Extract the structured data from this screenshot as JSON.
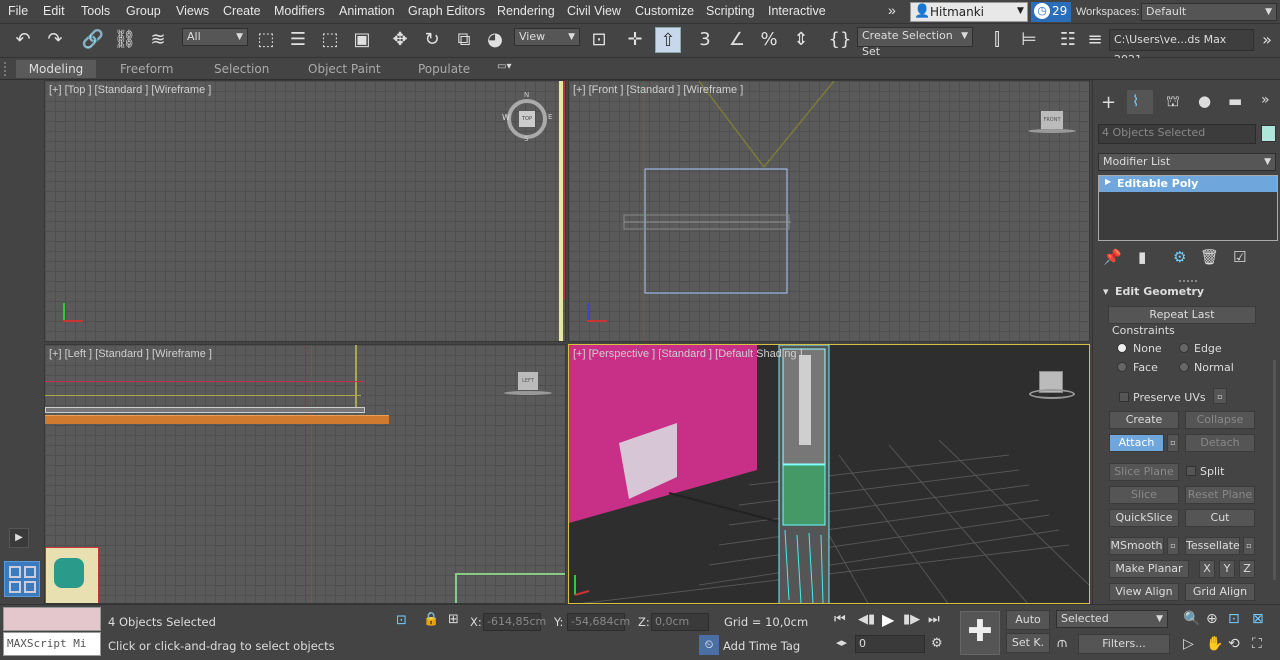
{
  "menubar": {
    "items": [
      "File",
      "Edit",
      "Tools",
      "Group",
      "Views",
      "Create",
      "Modifiers",
      "Animation",
      "Graph Editors",
      "Rendering",
      "Civil View",
      "Customize",
      "Scripting",
      "Interactive"
    ],
    "user": "Hitmanki",
    "notifications": "29",
    "workspaces_label": "Workspaces:",
    "workspace": "Default"
  },
  "toolbar": {
    "filter": "All",
    "ref_coord": "View",
    "selection_set": "Create Selection Set",
    "path": "C:\\Users\\ve...ds Max 2021"
  },
  "ribbon": {
    "tabs": [
      "Modeling",
      "Freeform",
      "Selection",
      "Object Paint",
      "Populate"
    ]
  },
  "viewports": {
    "top": "[+] [Top ] [Standard ] [Wireframe ]",
    "front": "[+] [Front ] [Standard ] [Wireframe ]",
    "left": "[+] [Left ] [Standard ] [Wireframe ]",
    "perspective": "[+] [Perspective ] [Standard ] [Default Shading ]",
    "cube_top": "TOP",
    "cube_front": "FRONT",
    "cube_left": "LEFT",
    "compass_w": "W",
    "compass_n": "N",
    "compass_s": "S",
    "compass_e": "E"
  },
  "command_panel": {
    "selected": "4 Objects Selected",
    "modifier_list": "Modifier List",
    "stack_item": "Editable Poly",
    "rollout": "Edit Geometry",
    "repeat_last": "Repeat Last",
    "constraints": "Constraints",
    "none": "None",
    "edge": "Edge",
    "face": "Face",
    "normal": "Normal",
    "preserve_uvs": "Preserve UVs",
    "create": "Create",
    "collapse": "Collapse",
    "attach": "Attach",
    "detach": "Detach",
    "slice_plane": "Slice Plane",
    "split": "Split",
    "slice": "Slice",
    "reset_plane": "Reset Plane",
    "quickslice": "QuickSlice",
    "cut": "Cut",
    "msmooth": "MSmooth",
    "tessellate": "Tessellate",
    "make_planar": "Make Planar",
    "x": "X",
    "y": "Y",
    "z": "Z",
    "view_align": "View Align",
    "grid_align": "Grid Align"
  },
  "status": {
    "maxscript": "MAXScript Mi",
    "selected": "4 Objects Selected",
    "prompt": "Click or click-and-drag to select objects",
    "x_label": "X:",
    "x_value": "-614,85cm",
    "y_label": "Y:",
    "y_value": "-54,684cm",
    "z_label": "Z:",
    "z_value": "0,0cm",
    "grid": "Grid = 10,0cm",
    "add_time_tag": "Add Time Tag",
    "frame": "0",
    "auto": "Auto",
    "setk": "Set K.",
    "key_mode": "Selected",
    "filters": "Filters..."
  }
}
